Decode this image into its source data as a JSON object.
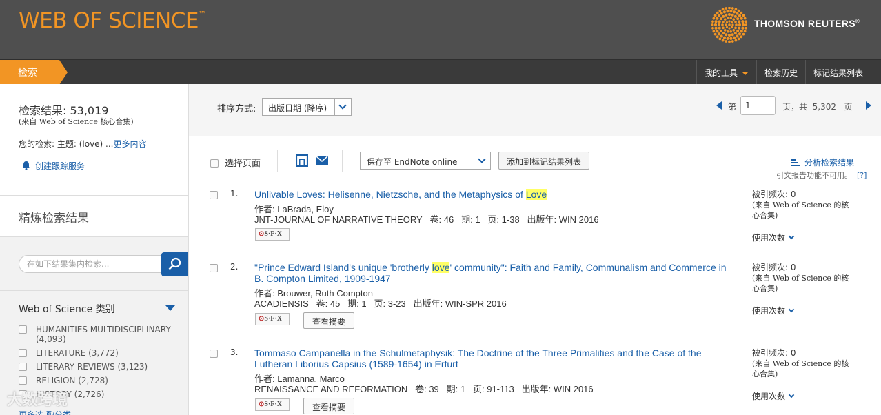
{
  "header": {
    "brand": "WEB OF SCIENCE",
    "brand_tm": "™",
    "company": "THOMSON REUTERS",
    "company_tm": "®"
  },
  "nav": {
    "search_tab": "检索",
    "links": [
      "我的工具",
      "检索历史",
      "标记结果列表"
    ]
  },
  "summary": {
    "count_label": "检索结果: 53,019",
    "source": "(来自 Web of Science 核心合集)",
    "your_search": "您的检索: 主题: (love) ...",
    "more_link": "更多内容",
    "alert": "创建跟踪服务"
  },
  "refine": {
    "heading": "精炼检索结果",
    "search_placeholder": "在如下结果集内检索...",
    "categories_heading": "Web of Science 类别",
    "categories": [
      "HUMANITIES MULTIDISCIPLINARY (4,093)",
      "LITERATURE (3,772)",
      "LITERARY REVIEWS (3,123)",
      "RELIGION (2,728)",
      "HISTORY (2,726)"
    ],
    "more_options": "更多选项/分类"
  },
  "sortbar": {
    "sort_label": "排序方式:",
    "sort_value": "出版日期 (降序)",
    "page_prefix": "第",
    "page_value": "1",
    "page_of": "页，共",
    "page_total": "5,302",
    "page_suffix": "页"
  },
  "toolbar": {
    "select_page": "选择页面",
    "save_to": "保存至 EndNote online",
    "add_marked": "添加到标记结果列表",
    "analyze": "分析检索结果",
    "cite_report": "引文报告功能不可用。",
    "cite_help": "[?]"
  },
  "labels": {
    "authors": "作者:",
    "volume": "卷:",
    "issue": "期:",
    "pages": "页:",
    "pubdate": "出版年:",
    "view_abstract": "查看摘要",
    "usage": "使用次数",
    "cited_prefix": "被引频次:",
    "cited_src": "(来自 Web of Science 的核心合集)"
  },
  "records": [
    {
      "num": "1.",
      "title_pre": "Unlivable Loves: Helisenne, Nietzsche, and the Metaphysics of ",
      "title_hl": "Love",
      "title_post": "",
      "authors": "LaBrada, Eloy",
      "journal": "JNT-JOURNAL OF NARRATIVE THEORY",
      "volume": "46",
      "issue": "1",
      "pages": "1-38",
      "pubdate": "WIN 2016",
      "cited": "0",
      "has_abstract": false
    },
    {
      "num": "2.",
      "title_pre": "\"Prince Edward Island's unique 'brotherly ",
      "title_hl": "love",
      "title_post": "' community\": Faith and Family, Communalism and Commerce in B. Compton Limited, 1909-1947",
      "authors": "Brouwer, Ruth Compton",
      "journal": "ACADIENSIS",
      "volume": "45",
      "issue": "1",
      "pages": "3-23",
      "pubdate": "WIN-SPR 2016",
      "cited": "0",
      "has_abstract": true
    },
    {
      "num": "3.",
      "title_pre": "Tommaso Campanella in the Schulmetaphysik: The Doctrine of the Three Primalities and the Case of the Lutheran Liborius Capsius (1589-1654) in Erfurt",
      "title_hl": "",
      "title_post": "",
      "authors": "Lamanna, Marco",
      "journal": "RENAISSANCE AND REFORMATION",
      "volume": "39",
      "issue": "1",
      "pages": "91-113",
      "pubdate": "WIN 2016",
      "cited": "0",
      "has_abstract": true
    }
  ],
  "watermark": "大数跨境",
  "colors": {
    "accent": "#f29524",
    "link": "#1a5fa8",
    "header_bg": "#4f4f4f",
    "nav_bg": "#3a3a3a",
    "highlight": "#ffff66"
  }
}
